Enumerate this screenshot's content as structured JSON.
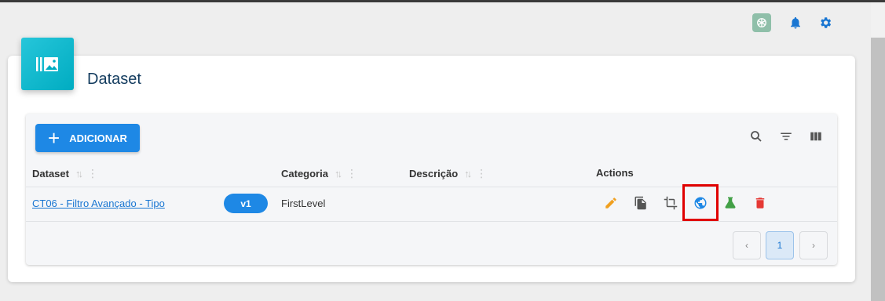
{
  "header": {
    "icons": [
      "chatgpt-icon",
      "bell-icon",
      "gear-icon"
    ],
    "accent": "#1976d2"
  },
  "card": {
    "title": "Dataset",
    "badge_icon": "image-library-icon",
    "badge_color": "#00acc1"
  },
  "toolbar": {
    "add_label": "ADICIONAR",
    "add_icon": "plus-icon",
    "icons": [
      "search-icon",
      "filter-icon",
      "columns-icon"
    ]
  },
  "table": {
    "columns": [
      {
        "label": "Dataset",
        "sortable": true
      },
      {
        "label": "Categoria",
        "sortable": true
      },
      {
        "label": "Descrição",
        "sortable": true
      },
      {
        "label": "Actions",
        "sortable": false
      }
    ],
    "rows": [
      {
        "dataset": "CT06 - Filtro Avançado - Tipo",
        "version": "v1",
        "categoria": "FirstLevel",
        "descricao": "",
        "actions": [
          "edit-icon",
          "copy-icon",
          "crop-icon",
          "globe-icon",
          "flask-icon",
          "delete-icon"
        ],
        "highlighted_action": "globe-icon"
      }
    ]
  },
  "pagination": {
    "prev": "‹",
    "current": "1",
    "next": "›"
  },
  "colors": {
    "edit": "#f0a020",
    "globe": "#1e88e5",
    "flask": "#43a047",
    "delete": "#e53935",
    "highlight": "#e00000"
  }
}
